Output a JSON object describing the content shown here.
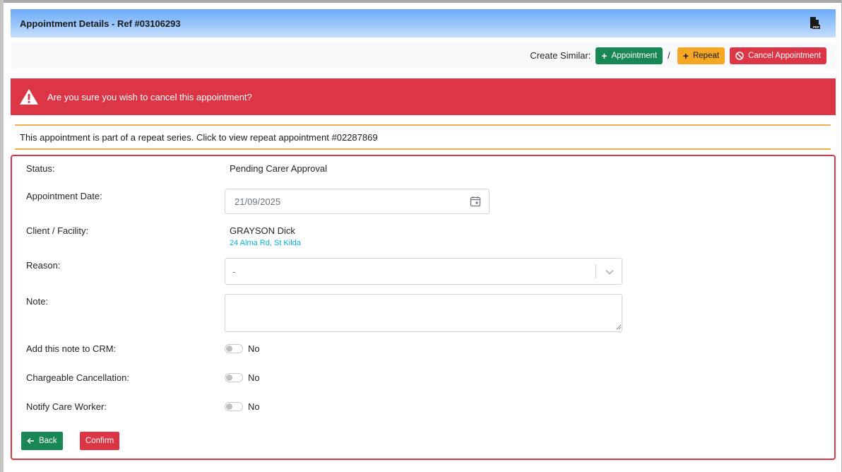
{
  "header": {
    "title": "Appointment Details - Ref #03106293",
    "pdf_icon": "pdf-file-icon"
  },
  "toolbar": {
    "create_similar_label": "Create Similar:",
    "separator": "/",
    "appointment_label": "Appointment",
    "repeat_label": "Repeat",
    "cancel_label": "Cancel Appointment"
  },
  "alert": {
    "message": "Are you sure you wish to cancel this appointment?",
    "icon": "warning-icon"
  },
  "info": {
    "message": "This appointment is part of a repeat series. Click to view repeat appointment #02287869"
  },
  "form": {
    "status_label": "Status:",
    "status_value": "Pending Carer Approval",
    "date_label": "Appointment Date:",
    "date_value": "21/09/2025",
    "client_label": "Client / Facility:",
    "client_name": "GRAYSON Dick",
    "client_address": "24 Alma Rd, St Kilda",
    "reason_label": "Reason:",
    "reason_value": "-",
    "note_label": "Note:",
    "note_value": "",
    "crm_label": "Add this note to CRM:",
    "crm_value": "No",
    "chargeable_label": "Chargeable Cancellation:",
    "chargeable_value": "No",
    "notify_label": "Notify Care Worker:",
    "notify_value": "No"
  },
  "actions": {
    "back_label": "Back",
    "confirm_label": "Confirm"
  },
  "colors": {
    "danger": "#dc3545",
    "success": "#198754",
    "warning": "#f5a623",
    "link": "#00b4d8"
  }
}
